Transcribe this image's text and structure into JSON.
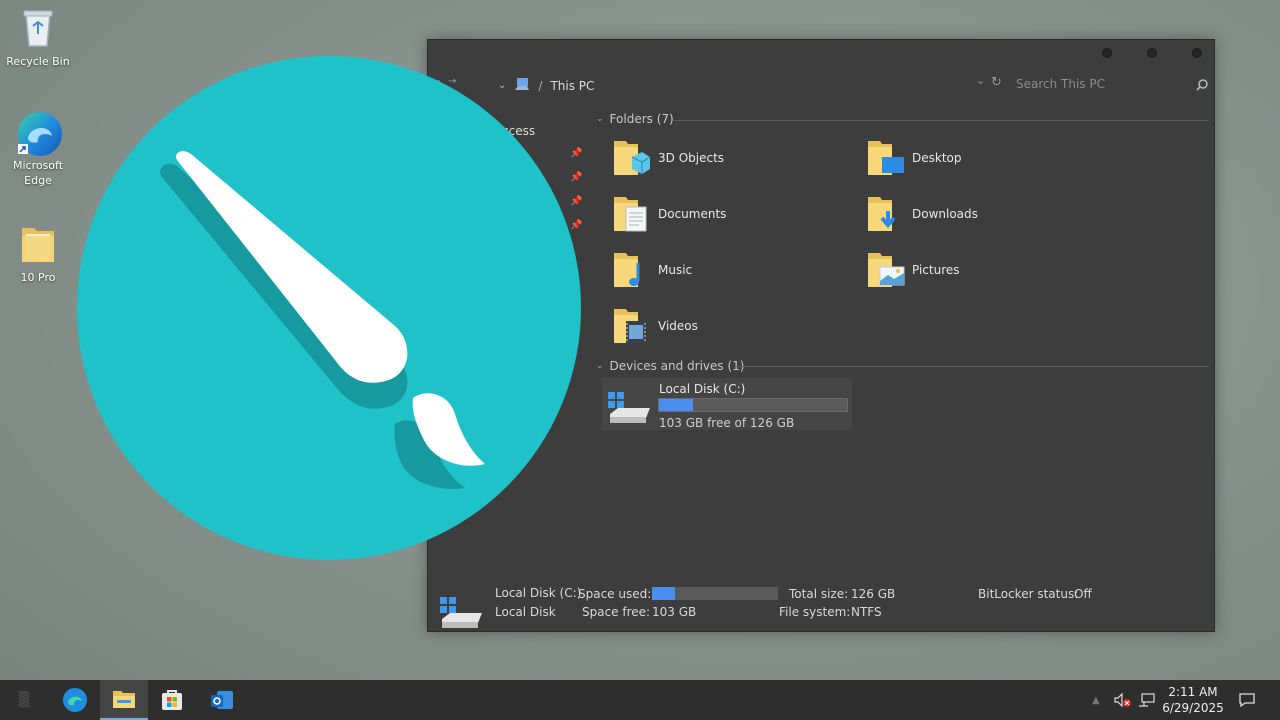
{
  "desktop": {
    "icons": [
      {
        "label": "Recycle Bin"
      },
      {
        "label": "Microsoft Edge"
      },
      {
        "label": "10 Pro"
      }
    ]
  },
  "explorer": {
    "breadcrumb": {
      "separator": "/",
      "location": "This PC"
    },
    "search_placeholder": "Search This PC",
    "sidebar": {
      "quick_access_label": "ccess"
    },
    "folders_header": "Folders (7)",
    "folders": [
      {
        "name": "3D Objects",
        "icon": "3d-objects-folder-icon"
      },
      {
        "name": "Desktop",
        "icon": "desktop-folder-icon"
      },
      {
        "name": "Documents",
        "icon": "documents-folder-icon"
      },
      {
        "name": "Downloads",
        "icon": "downloads-folder-icon"
      },
      {
        "name": "Music",
        "icon": "music-folder-icon"
      },
      {
        "name": "Pictures",
        "icon": "pictures-folder-icon"
      },
      {
        "name": "Videos",
        "icon": "videos-folder-icon"
      }
    ],
    "devices_header": "Devices and drives (1)",
    "drive": {
      "name": "Local Disk (C:)",
      "free_text": "103 GB free of 126 GB",
      "used_fraction": 0.18
    },
    "details": {
      "name": "Local Disk (C:)",
      "type": "Local Disk",
      "space_used_label": "Space used:",
      "space_used_fraction": 0.18,
      "space_free_label": "Space free:",
      "space_free_value": "103 GB",
      "total_size_label": "Total size:",
      "total_size_value": "126 GB",
      "file_system_label": "File system:",
      "file_system_value": "NTFS",
      "bitlocker_label": "BitLocker status:",
      "bitlocker_value": "Off"
    }
  },
  "overlay": {
    "icon": "paint-brush-icon",
    "color": "#1fc2c9"
  },
  "taskbar": {
    "apps": [
      "task-view-icon",
      "edge-icon",
      "file-explorer-icon",
      "store-icon",
      "outlook-icon"
    ],
    "clock": {
      "time": "2:11 AM",
      "date": "6/29/2025"
    },
    "accent": "#4a8ff0"
  }
}
